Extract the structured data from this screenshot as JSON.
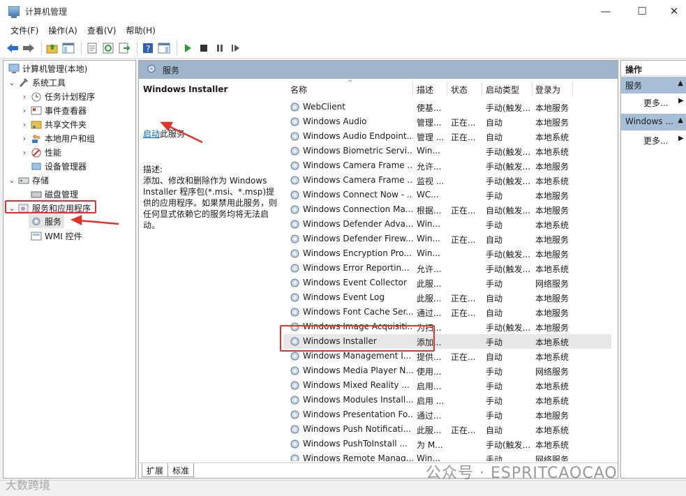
{
  "window": {
    "title": "计算机管理",
    "controls": {
      "minimize": "—",
      "maximize": "☐",
      "close": "✕"
    }
  },
  "menu": [
    "文件(F)",
    "操作(A)",
    "查看(V)",
    "帮助(H)"
  ],
  "toolbar_icons": [
    "back-icon",
    "forward-icon",
    "up-folder-icon",
    "show-hide-tree-icon",
    "properties-icon",
    "refresh-icon",
    "export-icon",
    "help-icon",
    "show-hide-action-pane-icon",
    "start-service-icon",
    "stop-service-icon",
    "pause-service-icon",
    "restart-service-icon"
  ],
  "tree": {
    "root": "计算机管理(本地)",
    "system_tools": "系统工具",
    "task_scheduler": "任务计划程序",
    "event_viewer": "事件查看器",
    "shared_folders": "共享文件夹",
    "local_users": "本地用户和组",
    "performance": "性能",
    "device_manager": "设备管理器",
    "storage": "存储",
    "disk_management": "磁盘管理",
    "services_apps": "服务和应用程序",
    "services": "服务",
    "wmi": "WMI 控件"
  },
  "center": {
    "header": "服务",
    "detail": {
      "service_name": "Windows Installer",
      "start_link": "启动",
      "start_suffix": "此服务",
      "desc_label": "描述:",
      "description": "添加、修改和删除作为 Windows Installer 程序包(*.msi、*.msp)提供的应用程序。如果禁用此服务，则任何显式依赖它的服务均将无法启动。"
    },
    "columns": {
      "name": "名称",
      "desc": "描述",
      "status": "状态",
      "startup": "启动类型",
      "logon": "登录为",
      "sort_indicator": "^"
    },
    "rows": [
      {
        "name": "WebClient",
        "desc": "使基...",
        "status": "",
        "startup": "手动(触发...",
        "logon": "本地服务"
      },
      {
        "name": "Windows Audio",
        "desc": "管理...",
        "status": "正在...",
        "startup": "自动",
        "logon": "本地服务"
      },
      {
        "name": "Windows Audio Endpoint...",
        "desc": "管理 ...",
        "status": "正在...",
        "startup": "自动",
        "logon": "本地系统"
      },
      {
        "name": "Windows Biometric Servi...",
        "desc": "Win...",
        "status": "",
        "startup": "手动(触发...",
        "logon": "本地系统"
      },
      {
        "name": "Windows Camera Frame ...",
        "desc": "允许...",
        "status": "",
        "startup": "手动(触发...",
        "logon": "本地服务"
      },
      {
        "name": "Windows Camera Frame ...",
        "desc": "监视 ...",
        "status": "",
        "startup": "手动(触发...",
        "logon": "本地系统"
      },
      {
        "name": "Windows Connect Now - ...",
        "desc": "WC...",
        "status": "",
        "startup": "手动",
        "logon": "本地服务"
      },
      {
        "name": "Windows Connection Ma...",
        "desc": "根据...",
        "status": "正在...",
        "startup": "自动(触发...",
        "logon": "本地服务"
      },
      {
        "name": "Windows Defender Adva...",
        "desc": "Win...",
        "status": "",
        "startup": "手动",
        "logon": "本地系统"
      },
      {
        "name": "Windows Defender Firew...",
        "desc": "Win...",
        "status": "正在...",
        "startup": "自动",
        "logon": "本地服务"
      },
      {
        "name": "Windows Encryption Pro...",
        "desc": "Win...",
        "status": "",
        "startup": "手动(触发...",
        "logon": "本地服务"
      },
      {
        "name": "Windows Error Reportin...",
        "desc": "允许...",
        "status": "",
        "startup": "手动(触发...",
        "logon": "本地系统"
      },
      {
        "name": "Windows Event Collector",
        "desc": "此服...",
        "status": "",
        "startup": "手动",
        "logon": "网络服务"
      },
      {
        "name": "Windows Event Log",
        "desc": "此服...",
        "status": "正在...",
        "startup": "自动",
        "logon": "本地服务"
      },
      {
        "name": "Windows Font Cache Ser...",
        "desc": "通过...",
        "status": "正在...",
        "startup": "自动",
        "logon": "本地服务"
      },
      {
        "name": "Windows Image Acquisiti...",
        "desc": "为扫...",
        "status": "",
        "startup": "手动(触发...",
        "logon": "本地服务"
      },
      {
        "name": "Windows Installer",
        "desc": "添加...",
        "status": "",
        "startup": "手动",
        "logon": "本地系统"
      },
      {
        "name": "Windows Management I...",
        "desc": "提供...",
        "status": "正在...",
        "startup": "自动",
        "logon": "本地系统"
      },
      {
        "name": "Windows Media Player N...",
        "desc": "使用...",
        "status": "",
        "startup": "手动",
        "logon": "网络服务"
      },
      {
        "name": "Windows Mixed Reality ...",
        "desc": "启用...",
        "status": "",
        "startup": "手动",
        "logon": "本地系统"
      },
      {
        "name": "Windows Modules Install...",
        "desc": "启用 ...",
        "status": "",
        "startup": "手动",
        "logon": "本地系统"
      },
      {
        "name": "Windows Presentation Fo...",
        "desc": "通过...",
        "status": "",
        "startup": "手动",
        "logon": "本地服务"
      },
      {
        "name": "Windows Push Notificati...",
        "desc": "此服...",
        "status": "正在...",
        "startup": "自动",
        "logon": "本地系统"
      },
      {
        "name": "Windows PushToInstall ...",
        "desc": "为 M...",
        "status": "",
        "startup": "手动(触发...",
        "logon": "本地系统"
      },
      {
        "name": "Windows Remote Manag...",
        "desc": "Win...",
        "status": "",
        "startup": "手动",
        "logon": "网络服务"
      }
    ],
    "tabs": [
      "扩展",
      "标准"
    ]
  },
  "actions": {
    "header": "操作",
    "group1": "服务",
    "more1": "更多...",
    "group2": "Windows ...",
    "more2": "更多..."
  },
  "watermark": "公众号 · ESPRITCAOCAO",
  "watermark2": "大数跨境",
  "colors": {
    "pane_header": "#9eb4ca",
    "action_group": "#a7bfd6",
    "annotation_red": "#e4312b",
    "link": "#0563c1"
  }
}
